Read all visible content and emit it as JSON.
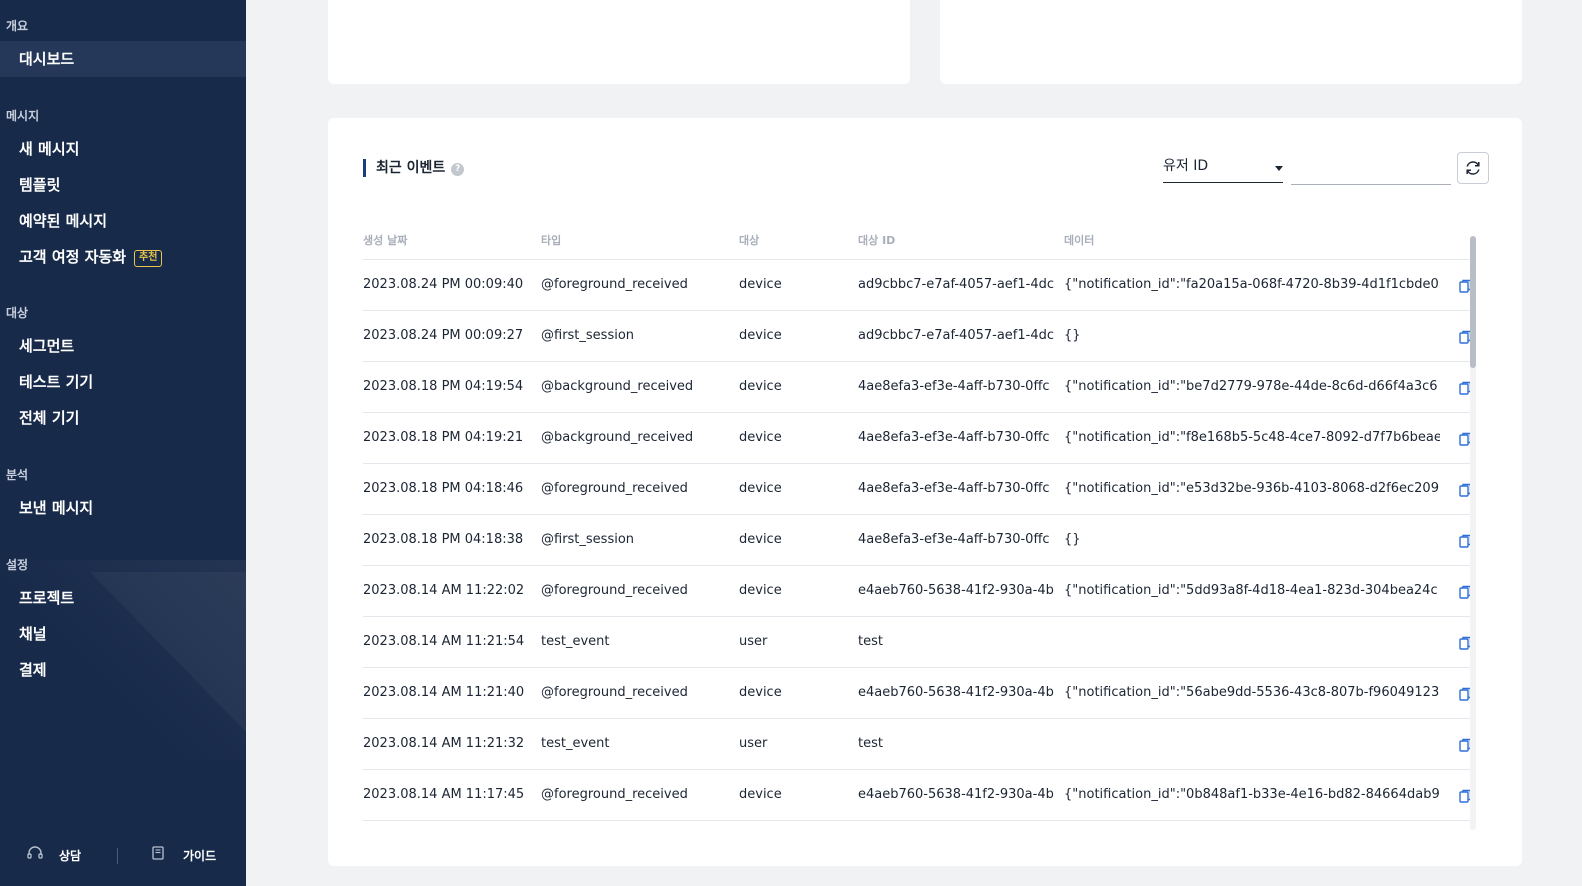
{
  "sidebar": {
    "sections": [
      {
        "title": "개요",
        "items": [
          {
            "label": "대시보드",
            "active": true
          }
        ]
      },
      {
        "title": "메시지",
        "items": [
          {
            "label": "새 메시지"
          },
          {
            "label": "템플릿"
          },
          {
            "label": "예약된 메시지"
          },
          {
            "label": "고객 여정 자동화",
            "badge": "추천"
          }
        ]
      },
      {
        "title": "대상",
        "items": [
          {
            "label": "세그먼트"
          },
          {
            "label": "테스트 기기"
          },
          {
            "label": "전체 기기"
          }
        ]
      },
      {
        "title": "분석",
        "items": [
          {
            "label": "보낸 메시지"
          }
        ]
      },
      {
        "title": "설정",
        "items": [
          {
            "label": "프로젝트"
          },
          {
            "label": "채널"
          },
          {
            "label": "결제"
          }
        ]
      }
    ],
    "footer": {
      "consult": "상담",
      "guide": "가이드"
    }
  },
  "events": {
    "title": "최근 이벤트",
    "filter": {
      "selected": "유저 ID",
      "input_value": ""
    },
    "columns": [
      "생성 날짜",
      "타입",
      "대상",
      "대상 ID",
      "데이터"
    ],
    "rows": [
      {
        "date": "2023.08.24 PM 00:09:40",
        "type": "@foreground_received",
        "target": "device",
        "target_id": "ad9cbbc7-e7af-4057-aef1-4dc",
        "data": "{\"notification_id\":\"fa20a15a-068f-4720-8b39-4d1f1cbde0"
      },
      {
        "date": "2023.08.24 PM 00:09:27",
        "type": "@first_session",
        "target": "device",
        "target_id": "ad9cbbc7-e7af-4057-aef1-4dc",
        "data": "{}"
      },
      {
        "date": "2023.08.18 PM 04:19:54",
        "type": "@background_received",
        "target": "device",
        "target_id": "4ae8efa3-ef3e-4aff-b730-0ffc",
        "data": "{\"notification_id\":\"be7d2779-978e-44de-8c6d-d66f4a3c6"
      },
      {
        "date": "2023.08.18 PM 04:19:21",
        "type": "@background_received",
        "target": "device",
        "target_id": "4ae8efa3-ef3e-4aff-b730-0ffc",
        "data": "{\"notification_id\":\"f8e168b5-5c48-4ce7-8092-d7f7b6beae"
      },
      {
        "date": "2023.08.18 PM 04:18:46",
        "type": "@foreground_received",
        "target": "device",
        "target_id": "4ae8efa3-ef3e-4aff-b730-0ffc",
        "data": "{\"notification_id\":\"e53d32be-936b-4103-8068-d2f6ec209"
      },
      {
        "date": "2023.08.18 PM 04:18:38",
        "type": "@first_session",
        "target": "device",
        "target_id": "4ae8efa3-ef3e-4aff-b730-0ffc",
        "data": "{}"
      },
      {
        "date": "2023.08.14 AM 11:22:02",
        "type": "@foreground_received",
        "target": "device",
        "target_id": "e4aeb760-5638-41f2-930a-4b",
        "data": "{\"notification_id\":\"5dd93a8f-4d18-4ea1-823d-304bea24c"
      },
      {
        "date": "2023.08.14 AM 11:21:54",
        "type": "test_event",
        "target": "user",
        "target_id": "test",
        "data": ""
      },
      {
        "date": "2023.08.14 AM 11:21:40",
        "type": "@foreground_received",
        "target": "device",
        "target_id": "e4aeb760-5638-41f2-930a-4b",
        "data": "{\"notification_id\":\"56abe9dd-5536-43c8-807b-f96049123"
      },
      {
        "date": "2023.08.14 AM 11:21:32",
        "type": "test_event",
        "target": "user",
        "target_id": "test",
        "data": ""
      },
      {
        "date": "2023.08.14 AM 11:17:45",
        "type": "@foreground_received",
        "target": "device",
        "target_id": "e4aeb760-5638-41f2-930a-4b",
        "data": "{\"notification_id\":\"0b848af1-b33e-4e16-bd82-84664dab9"
      }
    ]
  },
  "icons": {
    "refresh": "refresh-icon",
    "copy": "copy-icon",
    "help": "help-icon",
    "consult": "headset-icon",
    "guide": "book-icon"
  },
  "colors": {
    "sidebar_bg": "#182a4a",
    "accent": "#1f3d7a",
    "badge": "#e7c64b",
    "copy_icon": "#2f6fd6"
  }
}
